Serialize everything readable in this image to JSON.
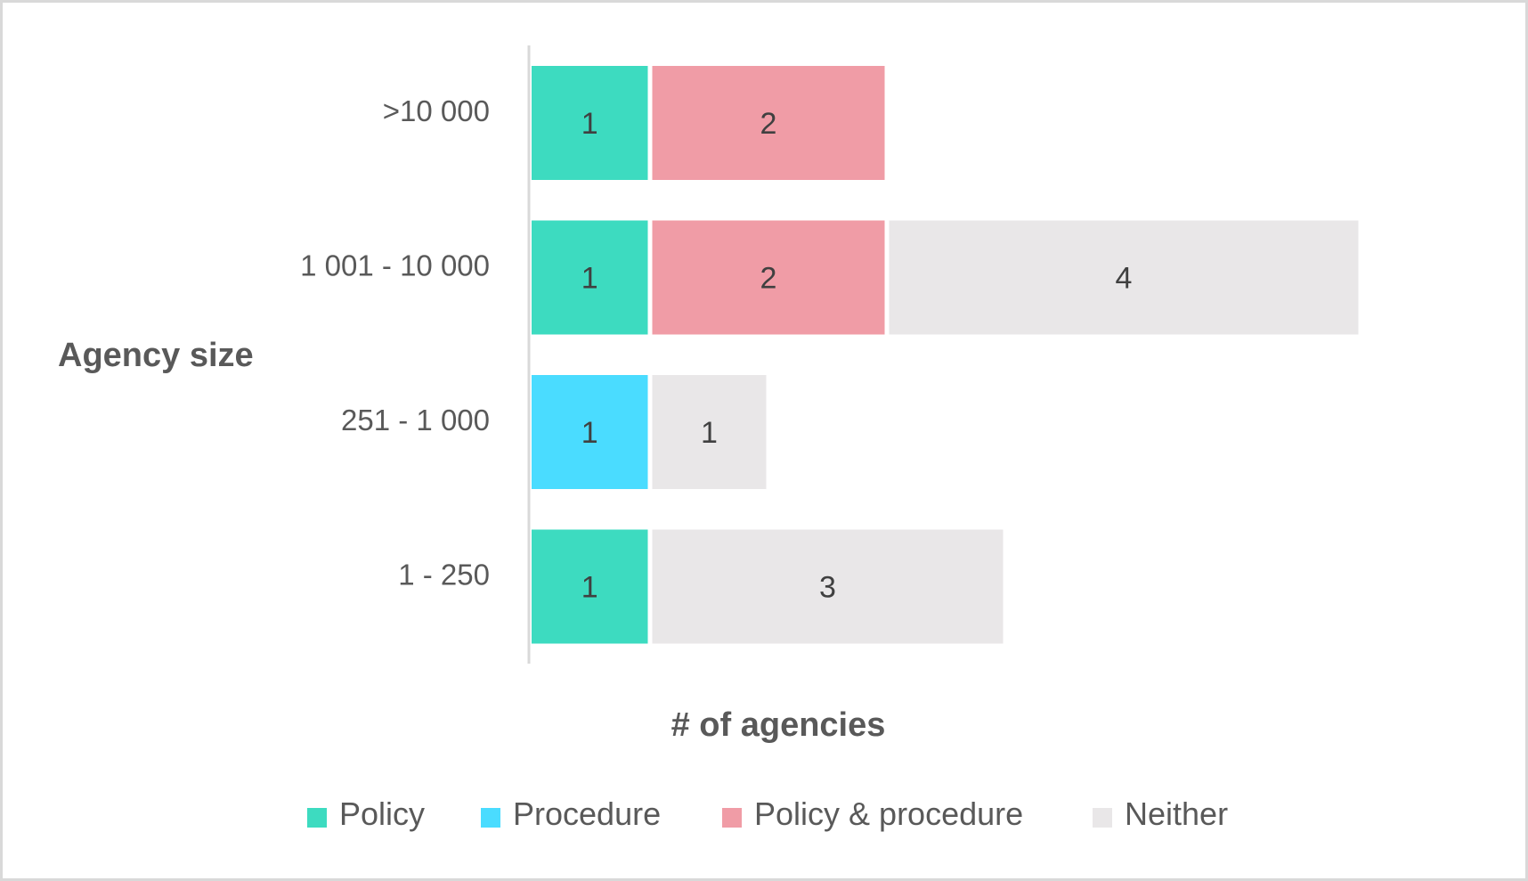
{
  "chart_data": {
    "type": "bar",
    "orientation": "horizontal",
    "stacked": true,
    "title": "",
    "xlabel": "# of agencies",
    "ylabel": "Agency size",
    "categories": [
      ">10 000",
      "1 001 - 10 000",
      "251 - 1 000",
      "1 - 250"
    ],
    "series": [
      {
        "name": "Policy",
        "color": "#3ddbc0",
        "values": [
          1,
          1,
          0,
          1
        ]
      },
      {
        "name": "Procedure",
        "color": "#4adcff",
        "values": [
          0,
          0,
          1,
          0
        ]
      },
      {
        "name": "Policy & procedure",
        "color": "#f09ca6",
        "values": [
          2,
          2,
          0,
          0
        ]
      },
      {
        "name": "Neither",
        "color": "#e9e7e8",
        "values": [
          0,
          4,
          1,
          3
        ]
      }
    ],
    "xlim": [
      0,
      7
    ],
    "grid": false,
    "data_labels": true,
    "legend_position": "bottom"
  }
}
